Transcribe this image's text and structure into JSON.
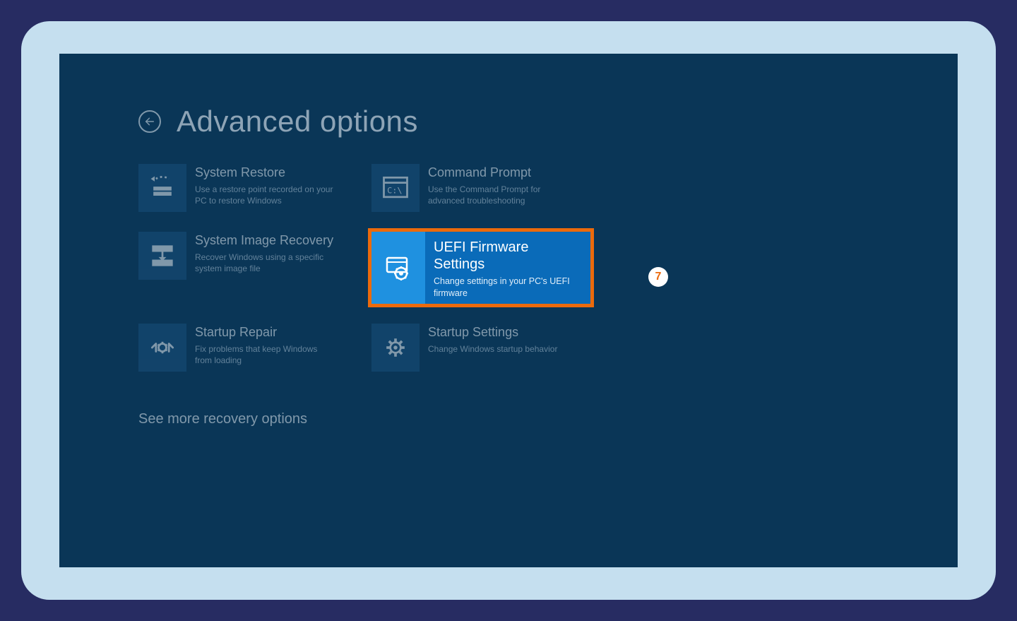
{
  "colors": {
    "page_bg": "#272c62",
    "frame_bg": "#c5dfef",
    "screen_bg": "#0a3657",
    "tile_icon_bg": "#174c77",
    "highlight_bg": "#0a6bb9",
    "highlight_icon_bg": "#1f91e0",
    "highlight_border": "#ec6a0c",
    "text_light": "#cfd9e2",
    "text_muted": "#9cb3c6"
  },
  "header": {
    "title": "Advanced options"
  },
  "tiles": {
    "system_restore": {
      "title": "System Restore",
      "desc": "Use a restore point recorded on your PC to restore Windows"
    },
    "command_prompt": {
      "title": "Command Prompt",
      "desc": "Use the Command Prompt for advanced troubleshooting"
    },
    "system_image_recovery": {
      "title": "System Image Recovery",
      "desc": "Recover Windows using a specific system image file"
    },
    "uefi": {
      "title": "UEFI Firmware Settings",
      "desc": "Change settings in your PC's UEFI firmware"
    },
    "startup_repair": {
      "title": "Startup Repair",
      "desc": "Fix problems that keep Windows from loading"
    },
    "startup_settings": {
      "title": "Startup Settings",
      "desc": "Change Windows startup behavior"
    }
  },
  "more_link": "See more recovery options",
  "annotation": {
    "badge_number": "7"
  }
}
